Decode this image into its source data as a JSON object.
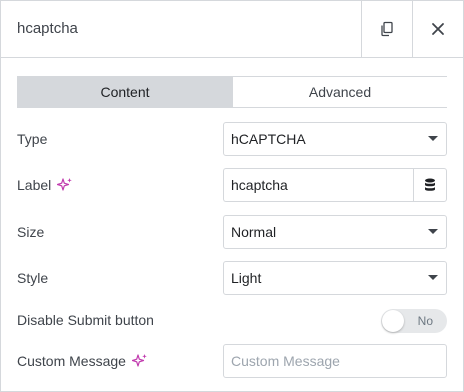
{
  "header": {
    "title": "hcaptcha",
    "copy_icon": "copy-icon",
    "close_icon": "close-icon"
  },
  "tabs": [
    {
      "label": "Content",
      "active": true
    },
    {
      "label": "Advanced",
      "active": false
    }
  ],
  "fields": {
    "type": {
      "label": "Type",
      "value": "hCAPTCHA"
    },
    "label": {
      "label": "Label",
      "value": "hcaptcha",
      "ai_icon": "ai-sparkle-icon",
      "dynamic_icon": "database-icon"
    },
    "size": {
      "label": "Size",
      "value": "Normal"
    },
    "style": {
      "label": "Style",
      "value": "Light"
    },
    "disable_submit": {
      "label": "Disable Submit button",
      "toggle_text": "No"
    },
    "custom_message": {
      "label": "Custom Message",
      "placeholder": "Custom Message",
      "value": "",
      "ai_icon": "ai-sparkle-icon"
    }
  },
  "colors": {
    "ai_icon": "#c13aae",
    "border": "#d5d8dc",
    "active_tab": "#d5d8dc"
  }
}
